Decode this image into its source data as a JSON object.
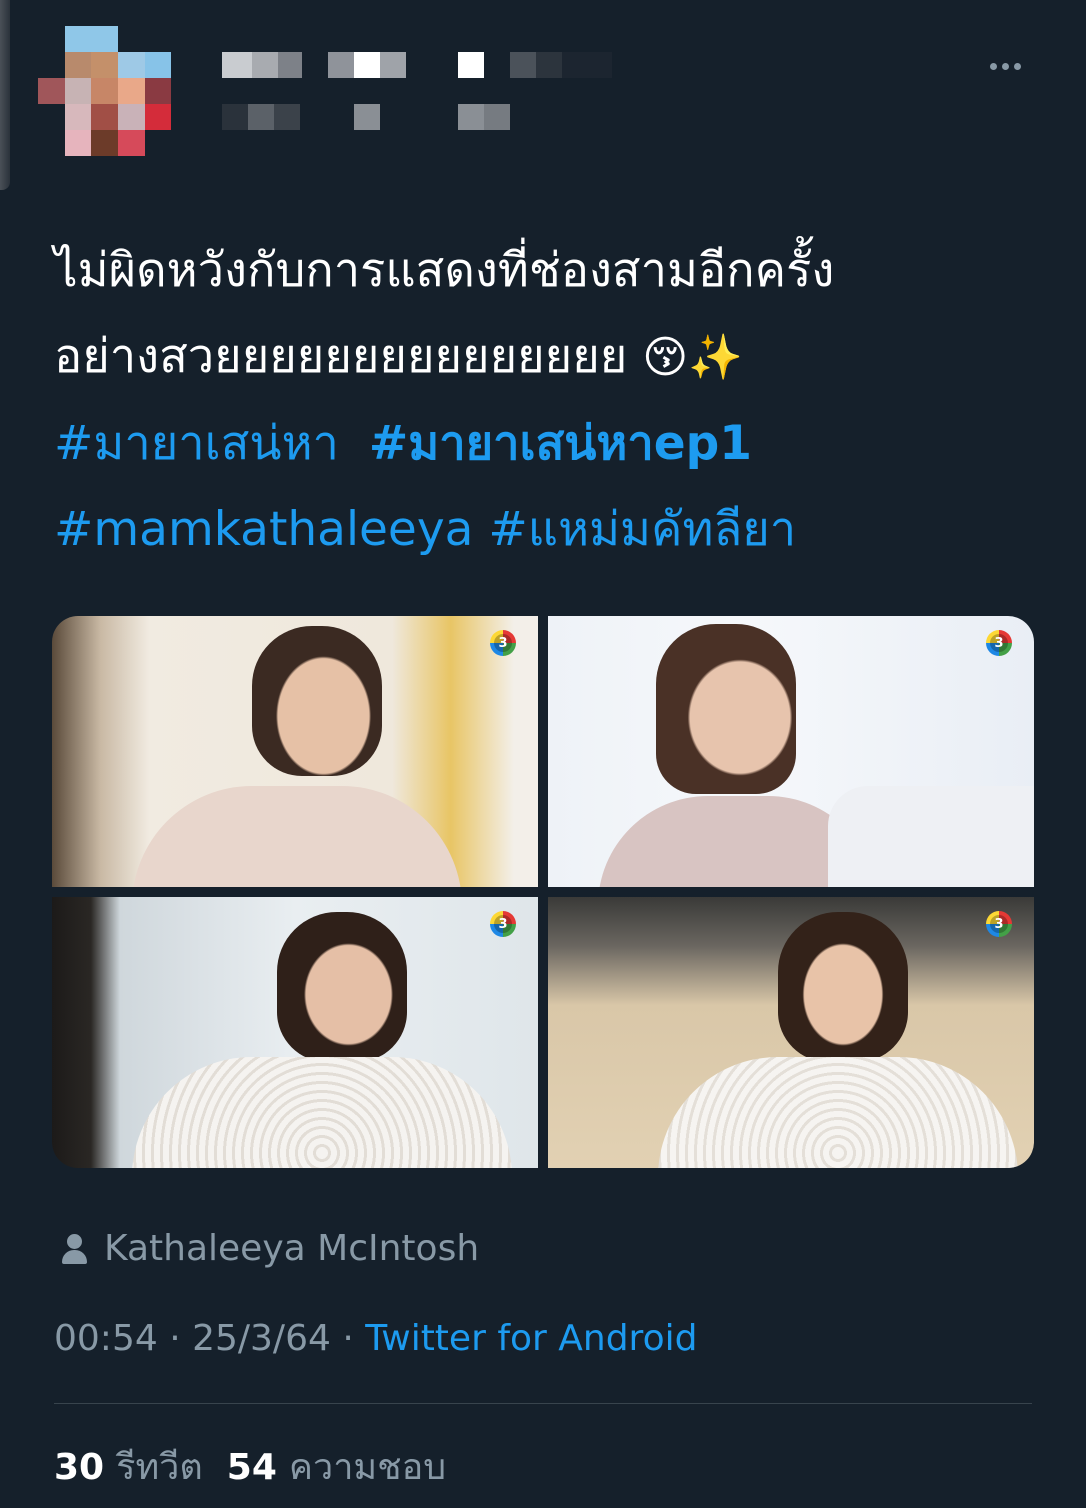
{
  "tweet": {
    "line1": "ไม่ผิดหวังกับการแสดงที่ช่องสามอีกครั้ง",
    "line2": "อย่างสวยยยยยยยยยยยยยยย",
    "emoji_kiss": "😚",
    "emoji_sparkles": "✨",
    "hashtags": [
      "#มายาเสน่หา",
      "#มายาเสน่หาep1",
      "#mamkathaleeya",
      "#แหม่มคัทลียา"
    ]
  },
  "media": {
    "channel_badge": "3"
  },
  "tagged_user": "Kathaleeya McIntosh",
  "meta": {
    "time": "00:54",
    "separator": " · ",
    "date": "25/3/64",
    "source": "Twitter for Android"
  },
  "stats": {
    "retweets_count": "30",
    "retweets_label": "รีทวีต",
    "likes_count": "54",
    "likes_label": "ความชอบ"
  },
  "colors": {
    "background": "#15202b",
    "link": "#1d9bf0",
    "secondary_text": "#8899a6"
  }
}
